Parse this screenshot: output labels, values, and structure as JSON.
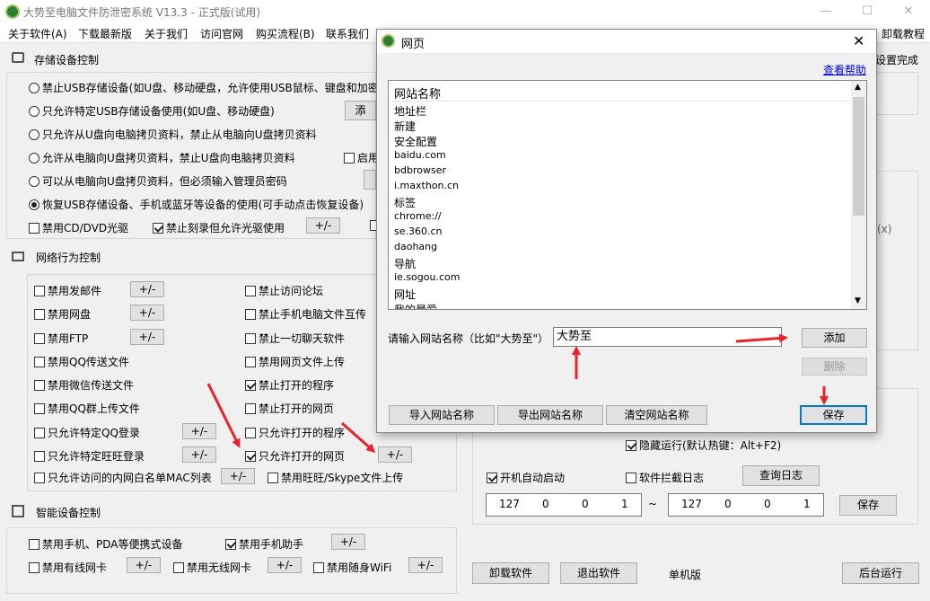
{
  "window": {
    "title": "大势至电脑文件防泄密系统 V13.3 - 正式版(试用)"
  },
  "menu": [
    "关于软件(A)",
    "下载最新版",
    "关于我们",
    "访问官网",
    "购买流程(B)",
    "联系我们"
  ],
  "menu_right": "卸载教程",
  "storage": {
    "title": "存储设备控制",
    "radios": [
      "禁止USB存储设备(如U盘、移动硬盘，允许使用USB鼠标、键盘和加密",
      "只允许特定USB存储设备使用(如U盘、移动硬盘)",
      "只允许从U盘向电脑拷贝资料，禁止从电脑向U盘拷贝资料",
      "允许从电脑向U盘拷贝资料，禁止U盘向电脑拷贝资料",
      "可以从电脑向U盘拷贝资料，但必须输入管理员密码",
      "恢复USB存储设备、手机或蓝牙等设备的使用(可手动点击恢复设备)"
    ],
    "add_btn": "添",
    "enable_cb": "启用",
    "cd_label": "禁用CD/DVD光驱",
    "burn_label": "禁止刻录但允许光驱使用",
    "pm": "+/-"
  },
  "network": {
    "title": "网络行为控制",
    "left": [
      {
        "label": "禁用发邮件",
        "pm": "+/-"
      },
      {
        "label": "禁用网盘",
        "pm": "+/-"
      },
      {
        "label": "禁用FTP",
        "pm": "+/-"
      },
      {
        "label": "禁用QQ传送文件",
        "pm": ""
      },
      {
        "label": "禁用微信传送文件",
        "pm": ""
      },
      {
        "label": "禁用QQ群上传文件",
        "pm": ""
      },
      {
        "label": "只允许特定QQ登录",
        "pm": "+/-"
      },
      {
        "label": "只允许特定旺旺登录",
        "pm": "+/-"
      }
    ],
    "right": [
      {
        "label": "禁止访问论坛",
        "checked": false
      },
      {
        "label": "禁止手机电脑文件互传",
        "checked": false
      },
      {
        "label": "禁止一切聊天软件",
        "checked": false
      },
      {
        "label": "禁用网页文件上传",
        "checked": false
      },
      {
        "label": "禁止打开的程序",
        "checked": true
      },
      {
        "label": "禁止打开的网页",
        "checked": false
      },
      {
        "label": "只允许打开的程序",
        "checked": false
      },
      {
        "label": "只允许打开的网页",
        "checked": true
      }
    ],
    "mac_label": "只允许访问的内网白名单MAC列表",
    "wangwang_label": "禁用旺旺/Skype文件上传",
    "pm": "+/-"
  },
  "smart": {
    "title": "智能设备控制",
    "phone_pda": "禁用手机、PDA等便携式设备",
    "phone_helper": "禁用手机助手",
    "wired": "禁用有线网卡",
    "wireless": "禁用无线网卡",
    "wifi": "禁用随身WiFi",
    "pm": "+/-"
  },
  "right_panel": {
    "settings_done": "设置完成",
    "x_hint": "(x)",
    "hide_run": "隐藏运行(默认热键：Alt+F2)",
    "auto_start": "开机自动启动",
    "block_log": "软件拦截日志",
    "query_log": "查询日志",
    "ip_start": [
      "127",
      "0",
      "0",
      "1"
    ],
    "ip_end": [
      "127",
      "0",
      "0",
      "1"
    ],
    "tilde": "~",
    "save": "保存",
    "uninstall": "卸载软件",
    "exit": "退出软件",
    "standalone": "单机版",
    "background": "后台运行"
  },
  "dialog": {
    "title": "网页",
    "help": "查看帮助",
    "list_header": "网站名称",
    "sites": [
      "地址栏",
      "新建",
      "安全配置",
      "baidu.com",
      "bdbrowser",
      "i.maxthon.cn",
      "标签",
      "chrome://",
      "se.360.cn",
      "daohang",
      "导航",
      "ie.sogou.com",
      "网址",
      "我的最爱"
    ],
    "input_label": "请输入网站名称（比如\"大势至\"）",
    "input_value": "大势至",
    "add": "添加",
    "delete": "删除",
    "import": "导入网站名称",
    "export": "导出网站名称",
    "clear": "清空网站名称",
    "save": "保存"
  }
}
